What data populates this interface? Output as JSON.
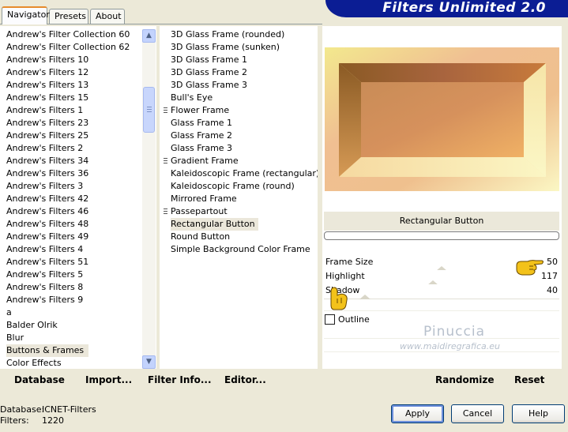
{
  "tabs": [
    "Navigator",
    "Presets",
    "About"
  ],
  "title": "Filters Unlimited 2.0",
  "categories": [
    "Andrew's Filter Collection 60",
    "Andrew's Filter Collection 62",
    "Andrew's Filters 10",
    "Andrew's Filters 12",
    "Andrew's Filters 13",
    "Andrew's Filters 15",
    "Andrew's Filters 1",
    "Andrew's Filters 23",
    "Andrew's Filters 25",
    "Andrew's Filters 2",
    "Andrew's Filters 34",
    "Andrew's Filters 36",
    "Andrew's Filters 3",
    "Andrew's Filters 42",
    "Andrew's Filters 46",
    "Andrew's Filters 48",
    "Andrew's Filters 49",
    "Andrew's Filters 4",
    "Andrew's Filters 51",
    "Andrew's Filters 5",
    "Andrew's Filters 8",
    "Andrew's Filters 9",
    "a",
    "Balder Olrik",
    "Blur",
    "Buttons & Frames",
    "Color Effects"
  ],
  "selected_category": "Buttons & Frames",
  "filters": [
    {
      "label": "3D Glass Frame (rounded)",
      "group": false
    },
    {
      "label": "3D Glass Frame (sunken)",
      "group": false
    },
    {
      "label": "3D Glass Frame 1",
      "group": false
    },
    {
      "label": "3D Glass Frame 2",
      "group": false
    },
    {
      "label": "3D Glass Frame 3",
      "group": false
    },
    {
      "label": "Bull's Eye",
      "group": false
    },
    {
      "label": "Flower Frame",
      "group": true
    },
    {
      "label": "Glass Frame 1",
      "group": false
    },
    {
      "label": "Glass Frame 2",
      "group": false
    },
    {
      "label": "Glass Frame 3",
      "group": false
    },
    {
      "label": "Gradient Frame",
      "group": true
    },
    {
      "label": "Kaleidoscopic Frame (rectangular)",
      "group": false
    },
    {
      "label": "Kaleidoscopic Frame (round)",
      "group": false
    },
    {
      "label": "Mirrored Frame",
      "group": false
    },
    {
      "label": "Passepartout",
      "group": true
    },
    {
      "label": "Rectangular Button",
      "group": false
    },
    {
      "label": "Round Button",
      "group": false
    },
    {
      "label": "Simple Background Color Frame",
      "group": false
    }
  ],
  "selected_filter": "Rectangular Button",
  "filter_name": "Rectangular Button",
  "params": [
    {
      "label": "Frame Size",
      "value": "50",
      "level": 0.5
    },
    {
      "label": "Highlight",
      "value": "117",
      "level": 0.46
    },
    {
      "label": "Shadow",
      "value": "40",
      "level": 0.16
    }
  ],
  "outline_label": "Outline",
  "outline_checked": false,
  "watermark": {
    "name": "Pinuccia",
    "site": "www.maidiregrafica.eu"
  },
  "toolbar": {
    "database": "Database",
    "import": "Import...",
    "filter_info": "Filter Info...",
    "editor": "Editor...",
    "randomize": "Randomize",
    "reset": "Reset"
  },
  "status": {
    "database_label": "Database:",
    "database_value": "ICNET-Filters",
    "filters_label": "Filters:",
    "filters_value": "1220"
  },
  "buttons": {
    "apply": "Apply",
    "cancel": "Cancel",
    "help": "Help"
  },
  "icons": {
    "scroll_up": "scroll-up-icon",
    "scroll_down": "scroll-down-icon",
    "pointer": "pointing-hand-icon"
  },
  "colors": {
    "banner": "#0b1d94",
    "tab_accent": "#e68b2c"
  }
}
